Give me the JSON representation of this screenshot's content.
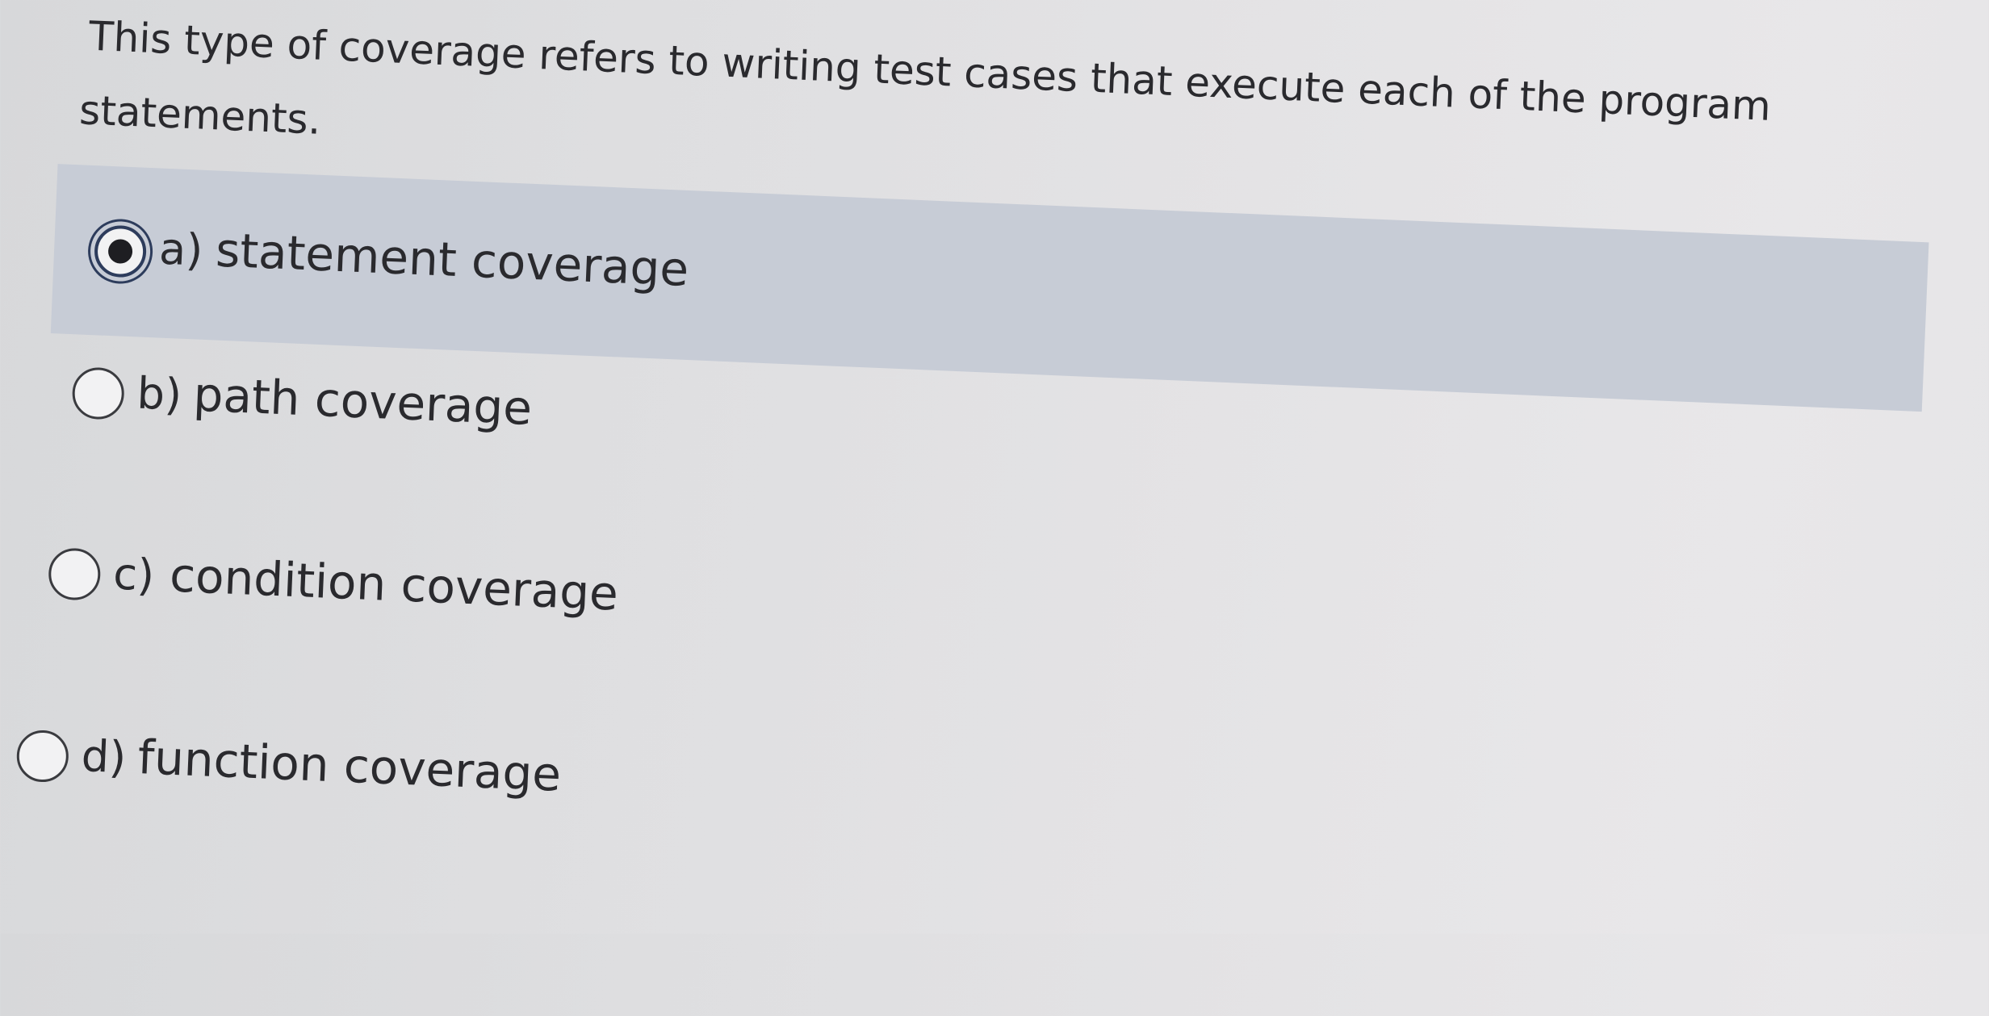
{
  "question": {
    "line1": "This type of coverage refers to writing test cases that execute each of the program",
    "line2": "statements."
  },
  "options": [
    {
      "letter": "a)",
      "text": "statement coverage",
      "selected": true
    },
    {
      "letter": "b)",
      "text": "path coverage",
      "selected": false
    },
    {
      "letter": "c)",
      "text": "condition coverage",
      "selected": false
    },
    {
      "letter": "d)",
      "text": "function coverage",
      "selected": false
    }
  ],
  "colors": {
    "selected_row_bg": "#c7ccd6",
    "radio_selected_ring": "#2d3c5c",
    "text": "#2a2a2e"
  }
}
